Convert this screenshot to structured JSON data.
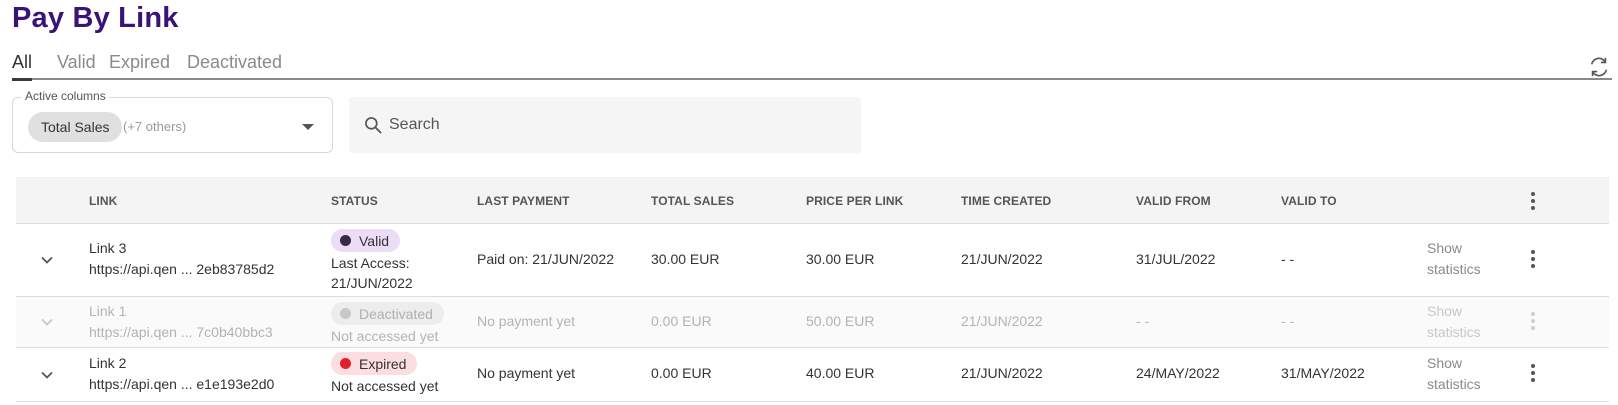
{
  "page": {
    "title": "Pay By Link"
  },
  "tabs": [
    {
      "label": "All"
    },
    {
      "label": "Valid"
    },
    {
      "label": "Expired"
    },
    {
      "label": "Deactivated"
    }
  ],
  "column_selector": {
    "legend": "Active columns",
    "chip": "Total Sales",
    "others": "(+7 others)"
  },
  "search": {
    "placeholder": "Search"
  },
  "table": {
    "headers": [
      "LINK",
      "STATUS",
      "LAST PAYMENT",
      "TOTAL SALES",
      "PRICE PER LINK",
      "TIME CREATED",
      "VALID FROM",
      "VALID TO"
    ],
    "rows": [
      {
        "name": "Link 3",
        "url": "https://api.qen ... 2eb83785d2",
        "status": "Valid",
        "access_line1": "Last Access:",
        "access_line2": "21/JUN/2022",
        "last_payment": "Paid on: 21/JUN/2022",
        "total_sales": "30.00 EUR",
        "price": "30.00 EUR",
        "created": "21/JUN/2022",
        "valid_from": "31/JUL/2022",
        "valid_to": "- -",
        "stats_line1": "Show",
        "stats_line2": "statistics"
      },
      {
        "name": "Link 1",
        "url": "https://api.qen ... 7c0b40bbc3",
        "status": "Deactivated",
        "access_line1": "Not accessed yet",
        "last_payment": "No payment yet",
        "total_sales": "0.00 EUR",
        "price": "50.00 EUR",
        "created": "21/JUN/2022",
        "valid_from": "- -",
        "valid_to": "- -",
        "stats_line1": "Show",
        "stats_line2": "statistics"
      },
      {
        "name": "Link 2",
        "url": "https://api.qen ... e1e193e2d0",
        "status": "Expired",
        "access_line1": "Not accessed yet",
        "last_payment": "No payment yet",
        "total_sales": "0.00 EUR",
        "price": "40.00 EUR",
        "created": "21/JUN/2022",
        "valid_from": "24/MAY/2022",
        "valid_to": "31/MAY/2022",
        "stats_line1": "Show",
        "stats_line2": "statistics"
      }
    ]
  },
  "colors": {
    "title": "#3a1378",
    "valid_badge": "#ecdcf6",
    "expired_badge": "#fcdde0",
    "expired_dot": "#e31f2d",
    "deactivated_badge": "#ededed"
  },
  "icons": [
    "refresh-icon",
    "search-icon",
    "chevron-down-icon",
    "more-vert-icon",
    "dropdown-caret-icon"
  ]
}
